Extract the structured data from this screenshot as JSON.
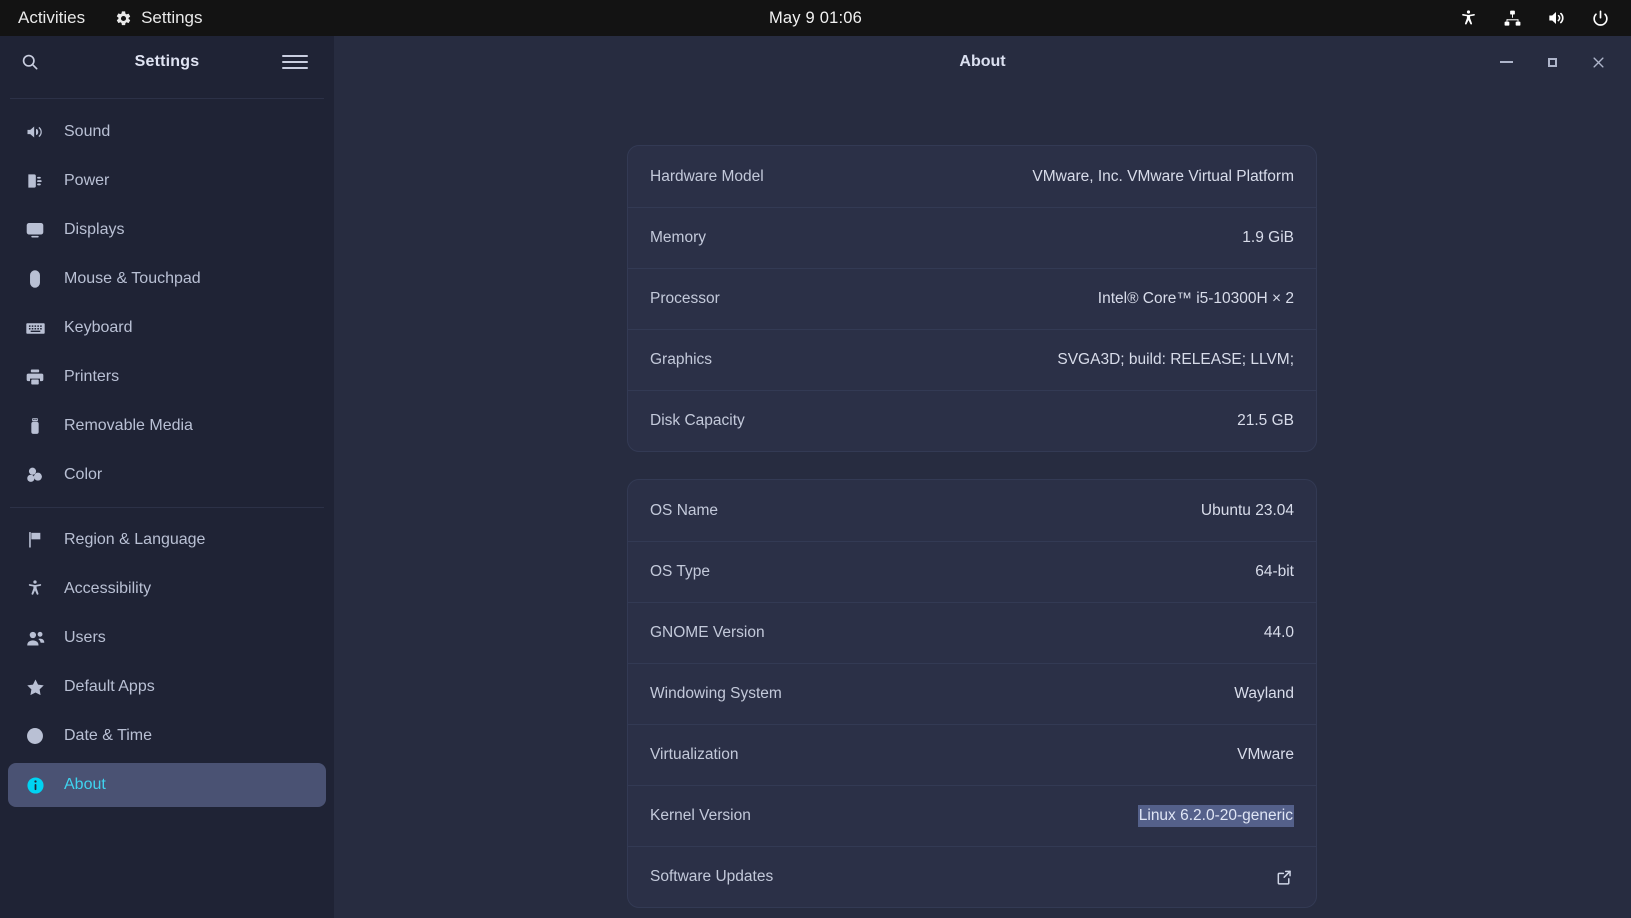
{
  "topbar": {
    "activities": "Activities",
    "app_name": "Settings",
    "app_icon": "gear-icon",
    "clock": "May 9  01:06",
    "status_icons": [
      "accessibility-icon",
      "network-icon",
      "volume-icon",
      "power-icon"
    ]
  },
  "sidebar": {
    "title": "Settings",
    "search_icon": "search-icon",
    "menu_icon": "hamburger-menu-icon",
    "items": [
      {
        "label": "Sound",
        "icon": "sound-icon",
        "selected": false
      },
      {
        "label": "Power",
        "icon": "power-plug-icon",
        "selected": false
      },
      {
        "label": "Displays",
        "icon": "display-icon",
        "selected": false
      },
      {
        "label": "Mouse & Touchpad",
        "icon": "mouse-icon",
        "selected": false
      },
      {
        "label": "Keyboard",
        "icon": "keyboard-icon",
        "selected": false
      },
      {
        "label": "Printers",
        "icon": "printer-icon",
        "selected": false
      },
      {
        "label": "Removable Media",
        "icon": "usb-drive-icon",
        "selected": false
      },
      {
        "label": "Color",
        "icon": "color-icon",
        "selected": false
      },
      {
        "label": "Region & Language",
        "icon": "flag-icon",
        "selected": false
      },
      {
        "label": "Accessibility",
        "icon": "accessibility-icon",
        "selected": false
      },
      {
        "label": "Users",
        "icon": "users-icon",
        "selected": false
      },
      {
        "label": "Default Apps",
        "icon": "star-icon",
        "selected": false
      },
      {
        "label": "Date & Time",
        "icon": "clock-icon",
        "selected": false
      },
      {
        "label": "About",
        "icon": "info-icon",
        "selected": true
      }
    ],
    "divider_after_index": 7,
    "selected_bg": "#4a5273",
    "selected_fg": "#3fd3ef"
  },
  "window": {
    "title": "About",
    "controls": {
      "minimize": "minimize-button",
      "maximize": "maximize-button",
      "close": "close-button"
    }
  },
  "about": {
    "hardware_card": [
      {
        "key": "Hardware Model",
        "value": "VMware, Inc. VMware Virtual Platform"
      },
      {
        "key": "Memory",
        "value": "1.9 GiB"
      },
      {
        "key": "Processor",
        "value": "Intel® Core™ i5-10300H × 2"
      },
      {
        "key": "Graphics",
        "value": "SVGA3D; build: RELEASE; LLVM;"
      },
      {
        "key": "Disk Capacity",
        "value": "21.5 GB"
      }
    ],
    "os_card": [
      {
        "key": "OS Name",
        "value": "Ubuntu 23.04"
      },
      {
        "key": "OS Type",
        "value": "64-bit"
      },
      {
        "key": "GNOME Version",
        "value": "44.0"
      },
      {
        "key": "Windowing System",
        "value": "Wayland"
      },
      {
        "key": "Virtualization",
        "value": "VMware"
      },
      {
        "key": "Kernel Version",
        "value": "Linux 6.2.0-20-generic",
        "selected": true
      },
      {
        "key": "Software Updates",
        "value": "",
        "link_icon": "external-link-icon"
      }
    ],
    "selection_highlight_color": "#54608a"
  }
}
